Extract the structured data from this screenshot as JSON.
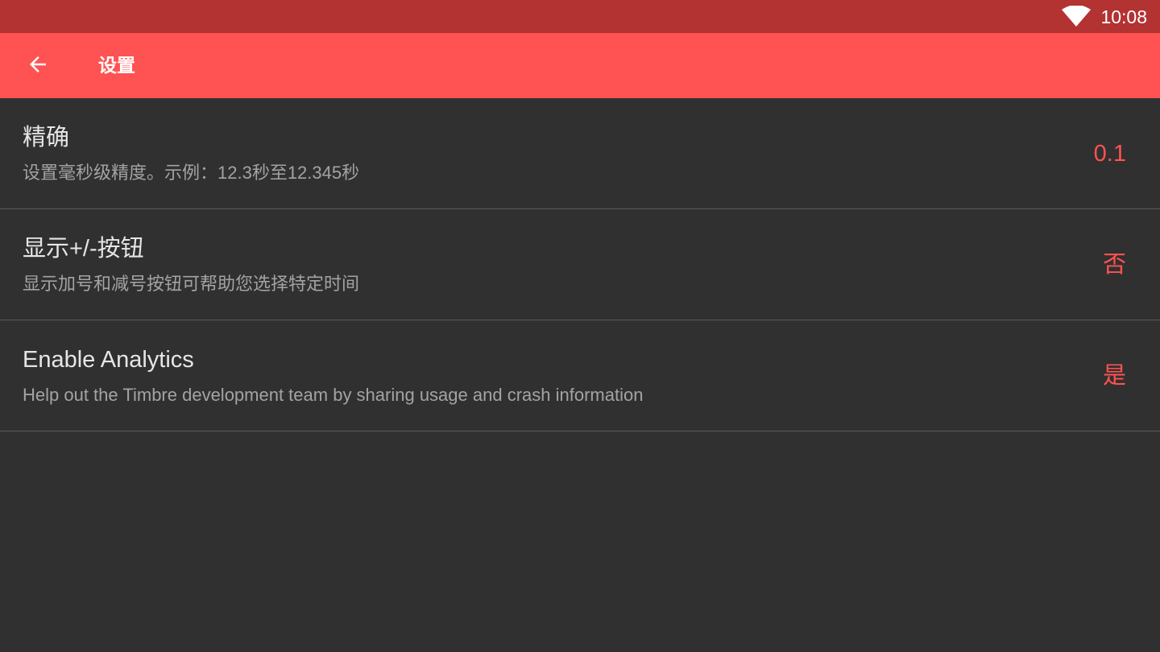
{
  "status_bar": {
    "time": "10:08",
    "wifi_icon": "wifi-icon"
  },
  "app_bar": {
    "back_icon": "arrow-back-icon",
    "title": "设置"
  },
  "colors": {
    "status_bar": "#b33232",
    "app_bar": "#ff5252",
    "background": "#303030",
    "accent": "#ff5252",
    "divider": "#5a5a5a"
  },
  "settings": [
    {
      "title": "精确",
      "summary": "设置毫秒级精度。示例：12.3秒至12.345秒",
      "value": "0.1"
    },
    {
      "title": "显示+/-按钮",
      "summary": "显示加号和减号按钮可帮助您选择特定时间",
      "value": "否"
    },
    {
      "title": "Enable Analytics",
      "summary": "Help out the Timbre development team by sharing usage and crash information",
      "value": "是"
    }
  ]
}
